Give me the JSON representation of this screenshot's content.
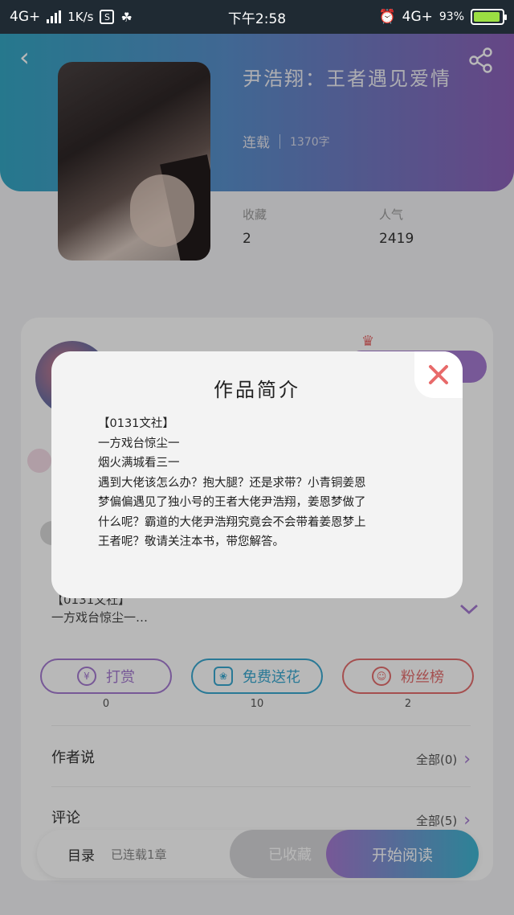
{
  "status_bar": {
    "network_left": "4G+",
    "speed": "1K/s",
    "sim_icon_text": "S",
    "time": "下午2:58",
    "network_right": "4G+",
    "battery": "93%",
    "battery_fill": 0.93,
    "battery_color": "#9bde43"
  },
  "header": {
    "book_title": "尹浩翔：王者遇见爱情",
    "status": "连载",
    "word_count": "1370字",
    "stats": [
      {
        "label": "收藏",
        "value": "2"
      },
      {
        "label": "人气",
        "value": "2419"
      }
    ],
    "gradient": [
      "#35a7c4",
      "#8d62b9"
    ]
  },
  "intro_snippet": {
    "line1": "【0131文社】",
    "line2": "一方戏台惊尘一…"
  },
  "actions": [
    {
      "label": "打赏",
      "icon": "yen-icon",
      "count": "0",
      "color": "#a57ad1"
    },
    {
      "label": "免费送花",
      "icon": "flower-icon",
      "count": "10",
      "color": "#3aa8d0"
    },
    {
      "label": "粉丝榜",
      "icon": "fan-user-icon",
      "count": "2",
      "color": "#e56e6e"
    }
  ],
  "sections": [
    {
      "label": "作者说",
      "right": "全部(0)"
    },
    {
      "label": "评论",
      "right": "全部(5)"
    }
  ],
  "bottom_bar": {
    "toc": "目录",
    "chapters": "已连载1章",
    "collected": "已收藏",
    "start_reading": "开始阅读"
  },
  "modal": {
    "title": "作品简介",
    "lines": [
      "【0131文社】",
      "一方戏台惊尘一",
      "烟火满城看三一",
      "遇到大佬该怎么办？抱大腿？还是求带？小青铜姜恩",
      "梦偏偏遇见了独小号的王者大佬尹浩翔，姜恩梦做了",
      "什么呢？霸道的大佬尹浩翔究竟会不会带着姜恩梦上",
      "王者呢？敬请关注本书，带您解答。"
    ],
    "close_color": "#e86a6a"
  }
}
